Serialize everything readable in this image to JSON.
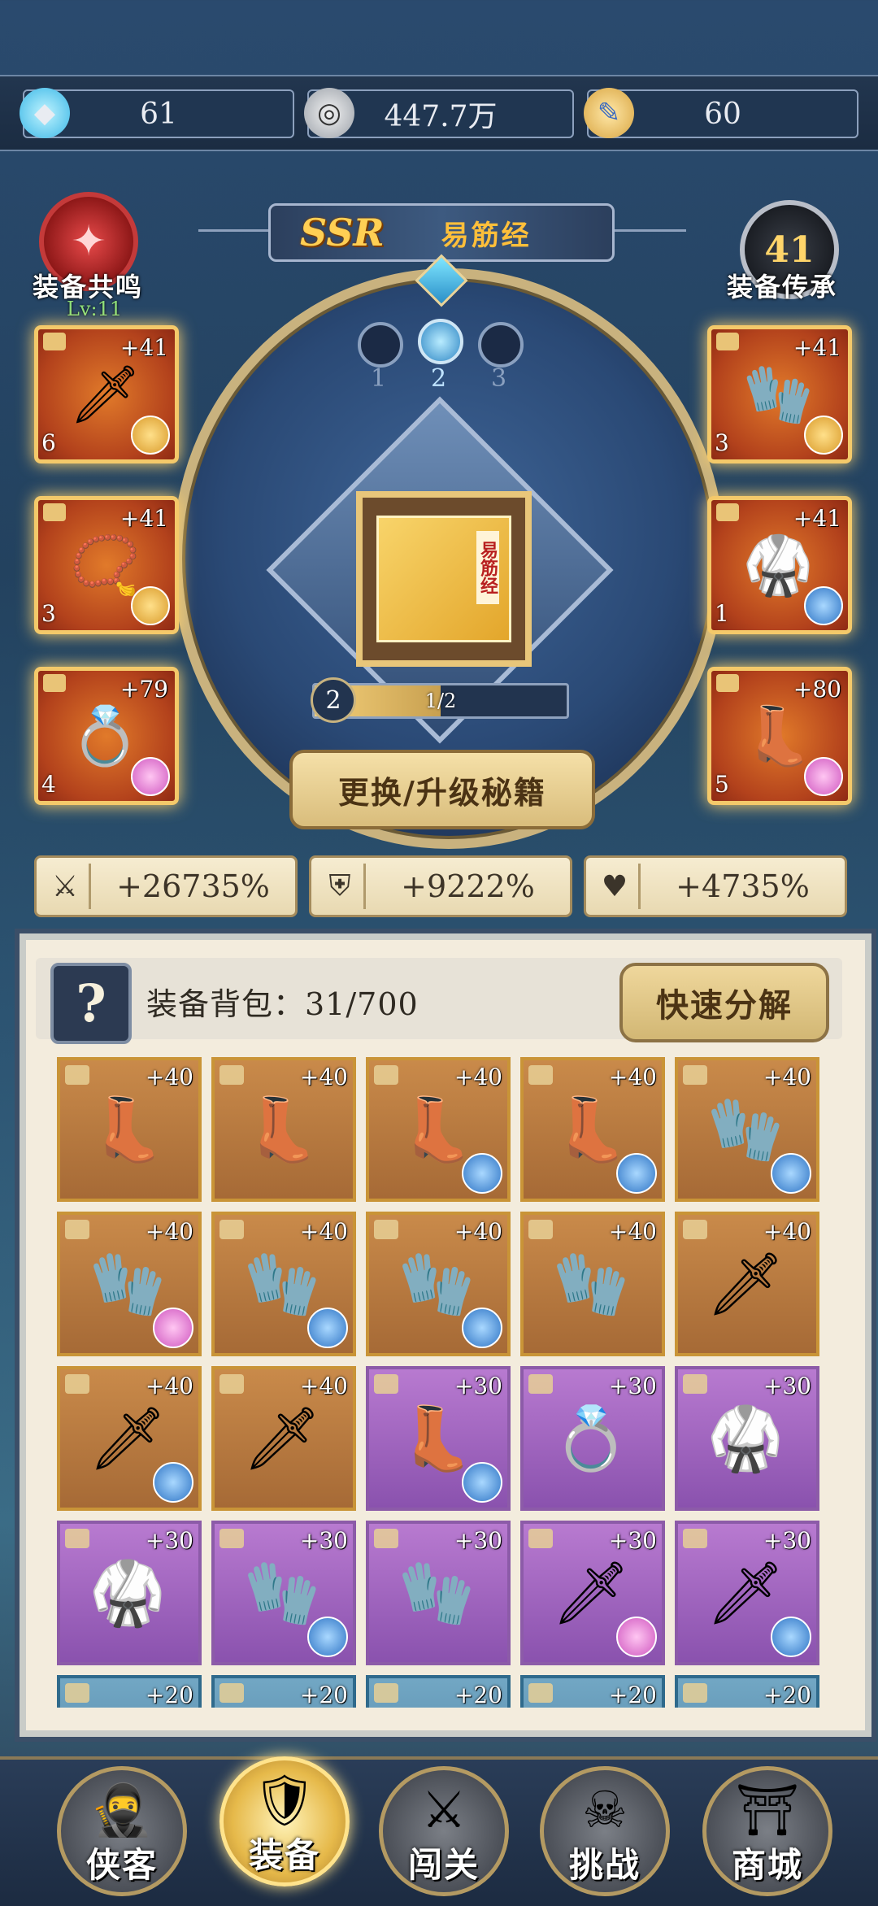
{
  "resources": {
    "gems": "61",
    "coins": "447.7万",
    "scrolls": "60"
  },
  "resonance": {
    "label": "装备共鸣",
    "level": "Lv:11"
  },
  "inheritance": {
    "label": "装备传承",
    "count": "41"
  },
  "manual": {
    "rarity": "SSR",
    "name": "易筋经",
    "book_label": "易筋经",
    "level": "2",
    "progress": "1/2",
    "progress_fraction": 0.5
  },
  "pages": [
    "1",
    "2",
    "3"
  ],
  "upgrade_button": "更换/升级秘籍",
  "equipped_left": [
    {
      "level": "+41",
      "stars": "6",
      "art": "sword",
      "orb": "gold"
    },
    {
      "level": "+41",
      "stars": "3",
      "art": "necklace",
      "orb": "gold"
    },
    {
      "level": "+79",
      "stars": "4",
      "art": "ring",
      "orb": "pink"
    }
  ],
  "equipped_right": [
    {
      "level": "+41",
      "stars": "3",
      "art": "bracer",
      "orb": "gold"
    },
    {
      "level": "+41",
      "stars": "1",
      "art": "armor",
      "orb": "blue"
    },
    {
      "level": "+80",
      "stars": "5",
      "art": "boots",
      "orb": "pink"
    }
  ],
  "stats": [
    {
      "icon": "swords-icon",
      "value": "+26735%"
    },
    {
      "icon": "shield-icon",
      "value": "+9222%"
    },
    {
      "icon": "heart-icon",
      "value": "+4735%"
    }
  ],
  "bag": {
    "title": "装备背包：31/700",
    "quick_button": "快速分解",
    "items": [
      {
        "level": "+40",
        "art": "boots",
        "tier": "orange",
        "orb": ""
      },
      {
        "level": "+40",
        "art": "boots",
        "tier": "orange",
        "orb": ""
      },
      {
        "level": "+40",
        "art": "boots",
        "tier": "orange",
        "orb": "blue"
      },
      {
        "level": "+40",
        "art": "boots",
        "tier": "orange",
        "orb": "blue"
      },
      {
        "level": "+40",
        "art": "bracer",
        "tier": "orange",
        "orb": "blue"
      },
      {
        "level": "+40",
        "art": "bracer",
        "tier": "orange",
        "orb": "pink"
      },
      {
        "level": "+40",
        "art": "bracer",
        "tier": "orange",
        "orb": "blue"
      },
      {
        "level": "+40",
        "art": "bracer",
        "tier": "orange",
        "orb": "blue"
      },
      {
        "level": "+40",
        "art": "bracer",
        "tier": "orange",
        "orb": ""
      },
      {
        "level": "+40",
        "art": "sword",
        "tier": "orange",
        "orb": ""
      },
      {
        "level": "+40",
        "art": "sword",
        "tier": "orange",
        "orb": "blue"
      },
      {
        "level": "+40",
        "art": "sword",
        "tier": "orange",
        "orb": ""
      },
      {
        "level": "+30",
        "art": "boots",
        "tier": "purple",
        "orb": "blue"
      },
      {
        "level": "+30",
        "art": "ring",
        "tier": "purple",
        "orb": ""
      },
      {
        "level": "+30",
        "art": "armor",
        "tier": "purple",
        "orb": ""
      },
      {
        "level": "+30",
        "art": "armor",
        "tier": "purple",
        "orb": ""
      },
      {
        "level": "+30",
        "art": "bracer",
        "tier": "purple",
        "orb": "blue"
      },
      {
        "level": "+30",
        "art": "bracer",
        "tier": "purple",
        "orb": ""
      },
      {
        "level": "+30",
        "art": "sword",
        "tier": "purple",
        "orb": "pink"
      },
      {
        "level": "+30",
        "art": "sword",
        "tier": "purple",
        "orb": "blue"
      },
      {
        "level": "+20",
        "art": "",
        "tier": "blue",
        "orb": ""
      },
      {
        "level": "+20",
        "art": "",
        "tier": "blue",
        "orb": ""
      },
      {
        "level": "+20",
        "art": "",
        "tier": "blue",
        "orb": ""
      },
      {
        "level": "+20",
        "art": "",
        "tier": "blue",
        "orb": ""
      },
      {
        "level": "+20",
        "art": "",
        "tier": "blue",
        "orb": ""
      }
    ]
  },
  "nav": [
    {
      "label": "侠客",
      "icon": "hero-icon",
      "active": false
    },
    {
      "label": "装备",
      "icon": "armor-icon",
      "active": true
    },
    {
      "label": "闯关",
      "icon": "stage-icon",
      "active": false
    },
    {
      "label": "挑战",
      "icon": "challenge-icon",
      "active": false
    },
    {
      "label": "商城",
      "icon": "shop-icon",
      "active": false
    }
  ],
  "colors": {
    "gold": "#f0b84a",
    "pink": "#e58ad6",
    "blue": "#3d87d6",
    "accent": "#f4c96a"
  }
}
